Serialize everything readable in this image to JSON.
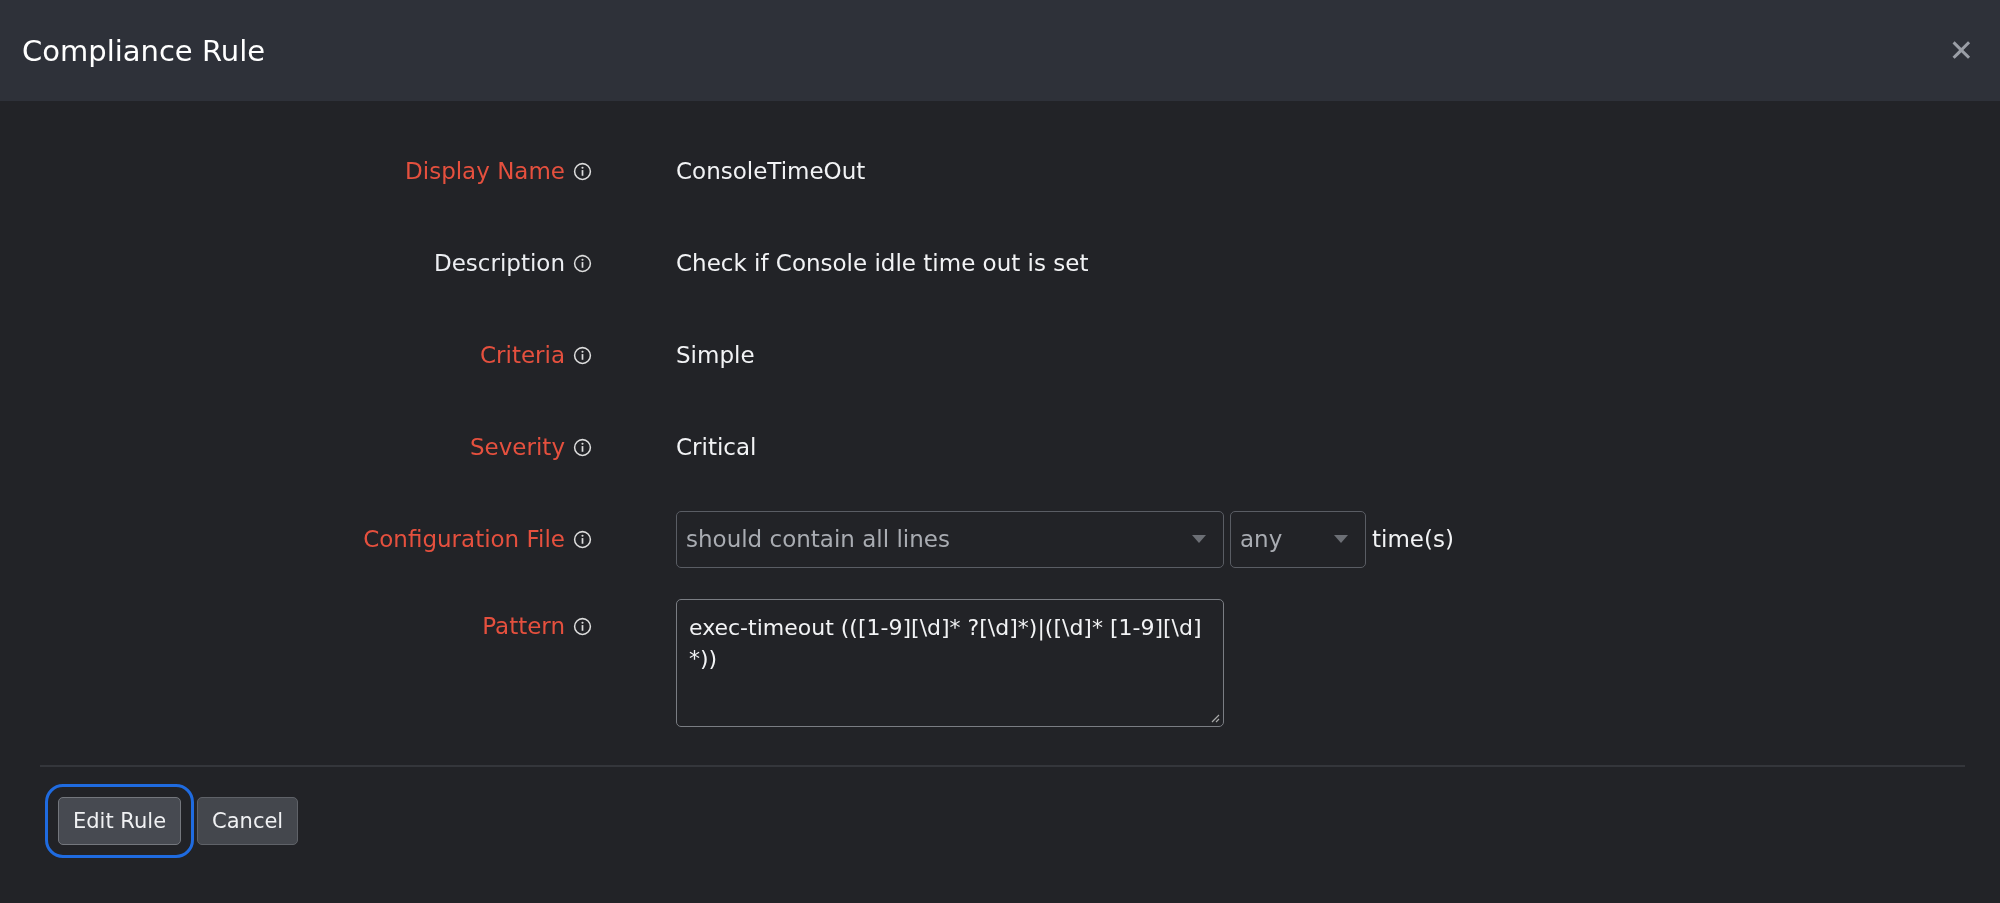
{
  "dialog": {
    "title": "Compliance Rule",
    "close_label": "✕"
  },
  "fields": [
    {
      "kind": "text",
      "label": "Display Name",
      "required": true,
      "value": "ConsoleTimeOut"
    },
    {
      "kind": "text",
      "label": "Description",
      "required": false,
      "value": "Check if Console idle time out is set"
    },
    {
      "kind": "text",
      "label": "Criteria",
      "required": true,
      "value": "Simple"
    },
    {
      "kind": "text",
      "label": "Severity",
      "required": true,
      "value": "Critical"
    },
    {
      "kind": "select",
      "label": "Configuration File",
      "required": true,
      "value": "should contain all lines",
      "count_value": "any",
      "suffix": "time(s)"
    },
    {
      "kind": "textarea",
      "label": "Pattern",
      "required": true,
      "value": "exec-timeout (([1-9][\\d]* ?[\\d]*)|([\\d]* [1-9][\\d]*))"
    }
  ],
  "buttons": [
    {
      "label": "Edit Rule",
      "focused": true
    },
    {
      "label": "Cancel",
      "focused": false
    }
  ]
}
